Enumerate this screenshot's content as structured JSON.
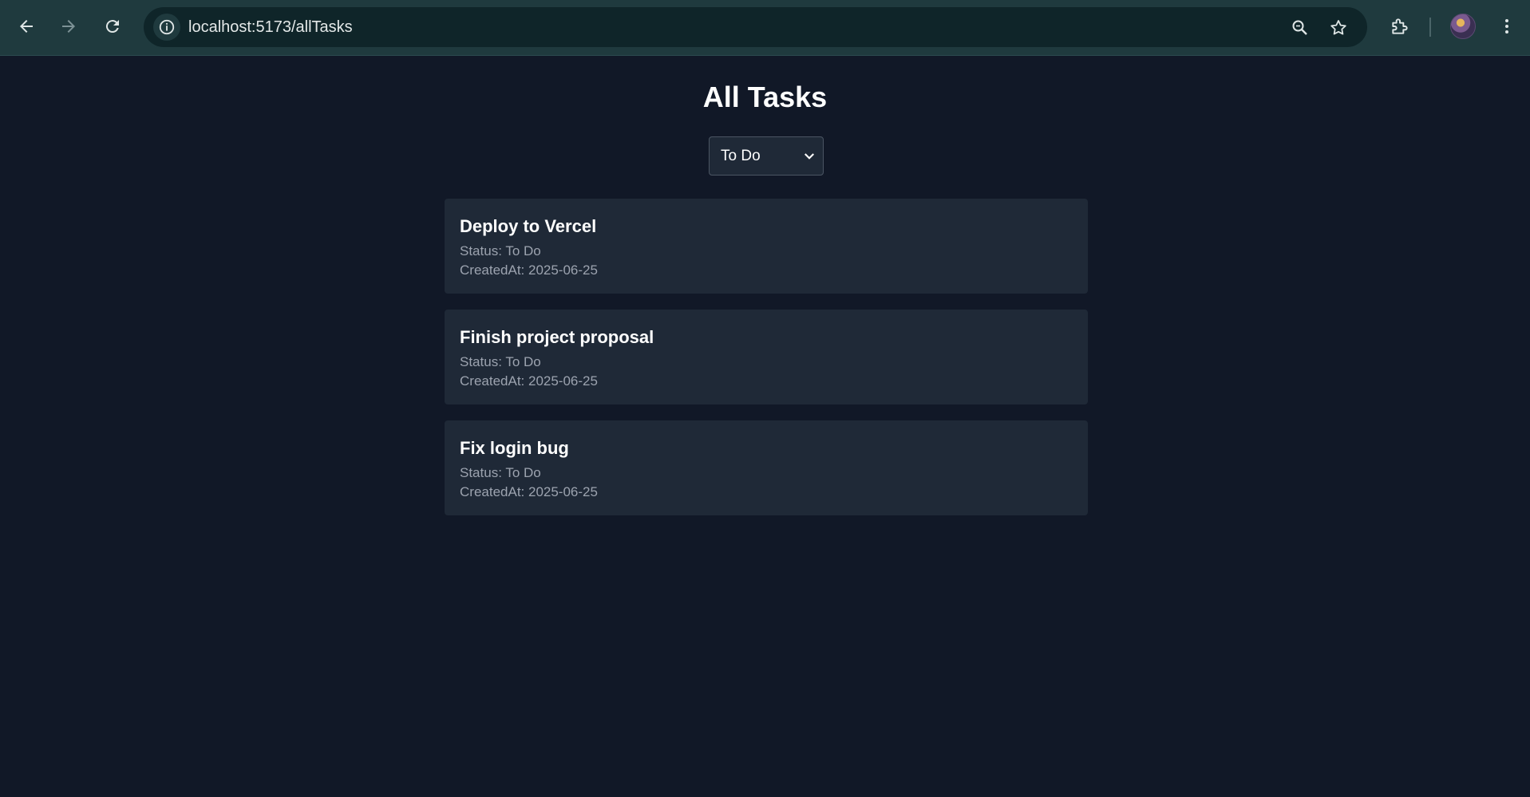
{
  "browser": {
    "url": "localhost:5173/allTasks",
    "icons": [
      "back-icon",
      "forward-icon",
      "reload-icon",
      "info-icon",
      "zoom-icon",
      "star-icon",
      "extensions-icon",
      "menu-icon"
    ]
  },
  "page": {
    "title": "All Tasks",
    "filter": {
      "selected": "To Do",
      "options": [
        "To Do"
      ]
    }
  },
  "tasks": [
    {
      "title": "Deploy to Vercel",
      "status": "Status: To Do",
      "created": "CreatedAt: 2025-06-25"
    },
    {
      "title": "Finish project proposal",
      "status": "Status: To Do",
      "created": "CreatedAt: 2025-06-25"
    },
    {
      "title": "Fix login bug",
      "status": "Status: To Do",
      "created": "CreatedAt: 2025-06-25"
    }
  ],
  "colors": {
    "page_bg": "#111827",
    "card_bg": "#1f2937",
    "chrome_bg": "#1f3a3e",
    "muted_text": "#9ca3af"
  }
}
